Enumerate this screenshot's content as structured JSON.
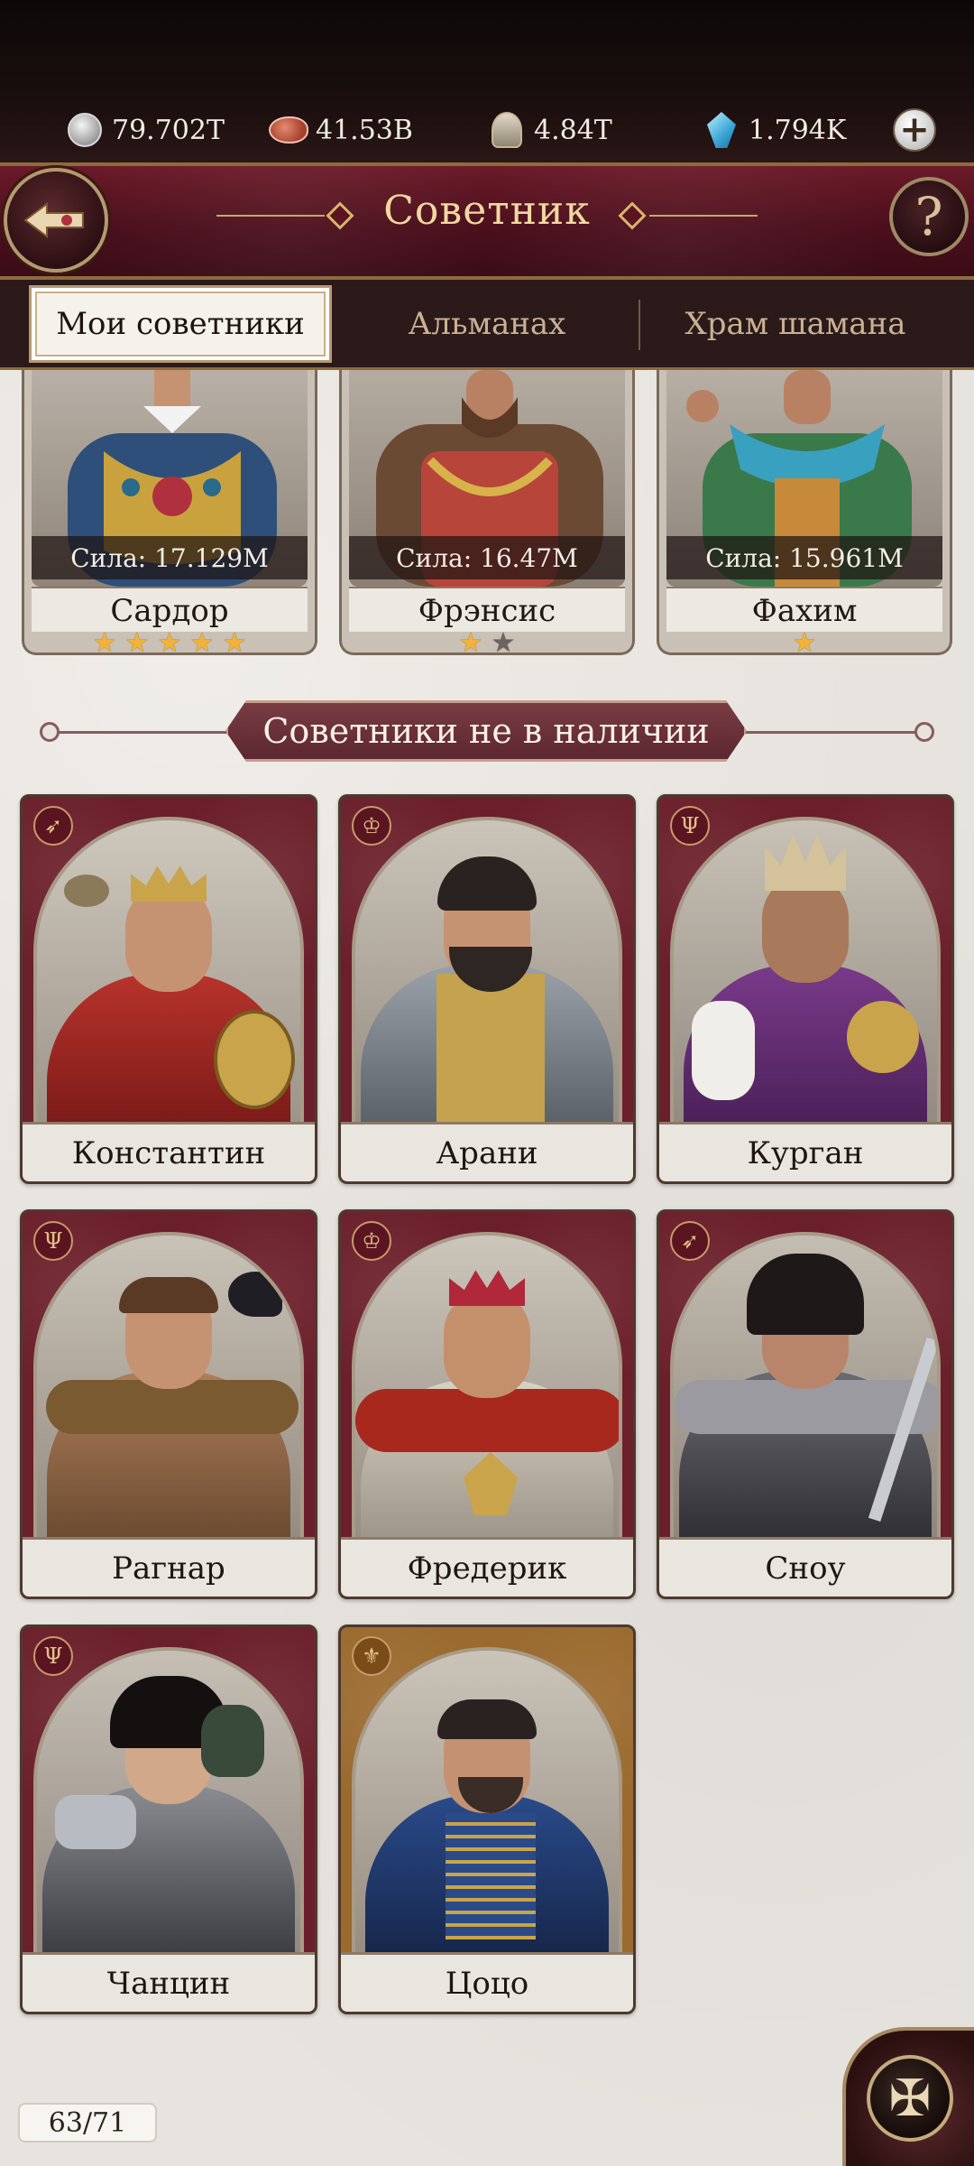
{
  "resources": [
    {
      "icon": "silver-coin-icon",
      "value": "79.702T"
    },
    {
      "icon": "meat-icon",
      "value": "41.53B"
    },
    {
      "icon": "helmet-icon",
      "value": "4.84T"
    },
    {
      "icon": "crystal-icon",
      "value": "1.794K"
    }
  ],
  "header": {
    "title": "Советник",
    "help_symbol": "?"
  },
  "tabs": [
    {
      "label": "Мои советники",
      "active": true
    },
    {
      "label": "Альманах",
      "active": false
    },
    {
      "label": "Храм шамана",
      "active": false
    }
  ],
  "owned_advisors": [
    {
      "name": "Сардор",
      "power": "Сила: 17.129M",
      "stars_filled": 5,
      "stars_total": 5
    },
    {
      "name": "Фрэнсис",
      "power": "Сила: 16.47M",
      "stars_filled": 1,
      "stars_total": 2
    },
    {
      "name": "Фахим",
      "power": "Сила: 15.961M",
      "stars_filled": 1,
      "stars_total": 1
    }
  ],
  "section": {
    "title": "Советники не в наличии"
  },
  "unavailable_advisors": [
    {
      "name": "Константин",
      "class_icon": "bow-icon"
    },
    {
      "name": "Арани",
      "class_icon": "crown-class-icon"
    },
    {
      "name": "Курган",
      "class_icon": "trident-icon"
    },
    {
      "name": "Рагнар",
      "class_icon": "trident-icon"
    },
    {
      "name": "Фредерик",
      "class_icon": "crown-class-icon"
    },
    {
      "name": "Сноу",
      "class_icon": "bow-icon"
    },
    {
      "name": "Чанцин",
      "class_icon": "trident-icon"
    },
    {
      "name": "Цоцо",
      "class_icon": "wheat-icon"
    }
  ],
  "footer": {
    "counter": "63/71"
  },
  "colors": {
    "card_red": "#6b1f2a",
    "card_gold": "#9a6a2e",
    "accent_gold": "#f0d9a0",
    "banner": "#5b2630"
  }
}
